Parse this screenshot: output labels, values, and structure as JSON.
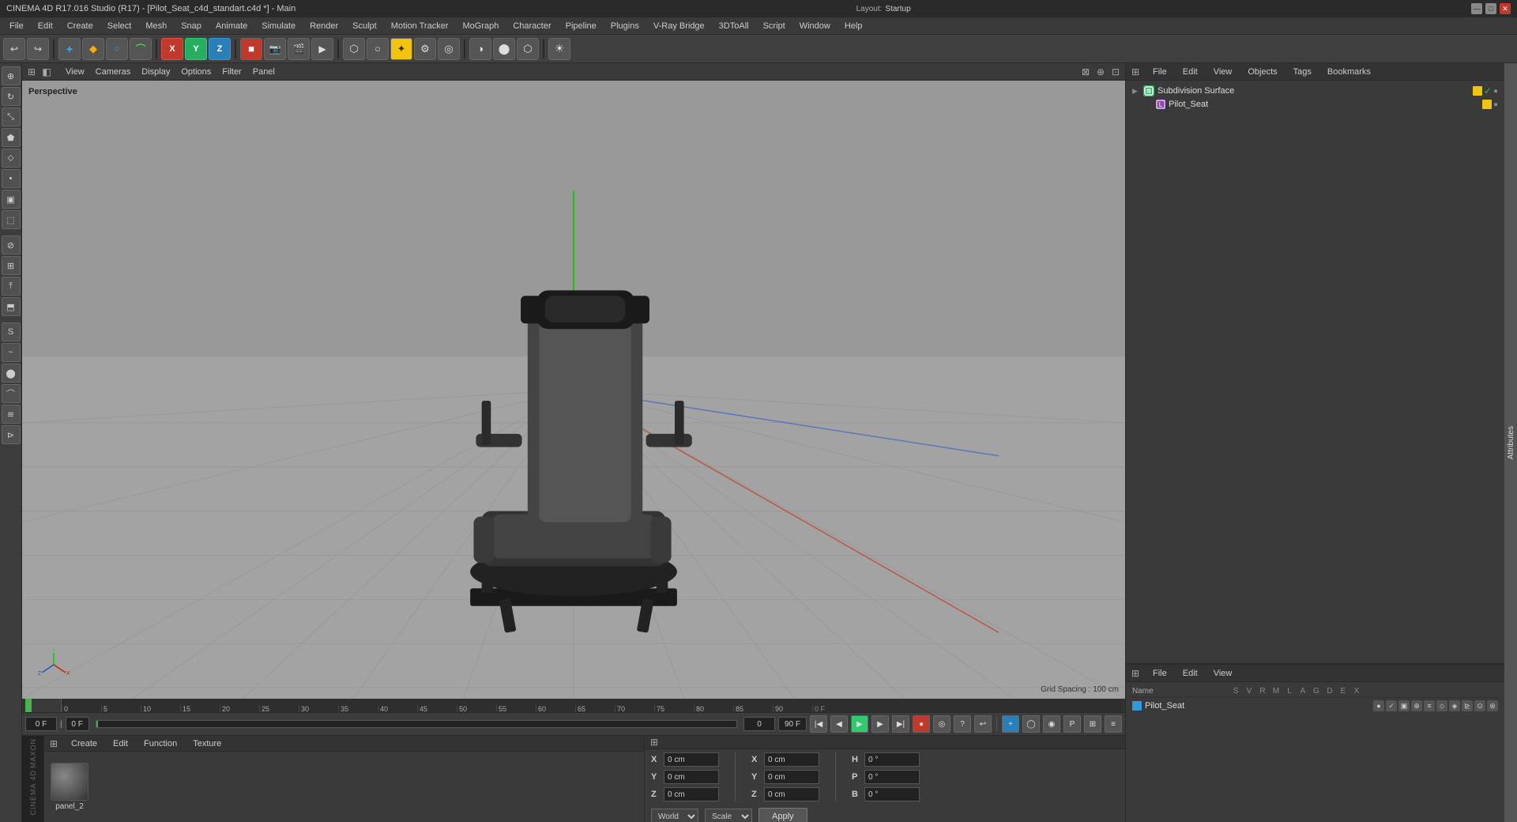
{
  "title_bar": {
    "text": "CINEMA 4D R17.016 Studio (R17) - [Pilot_Seat_c4d_standart.c4d *] - Main",
    "layout_label": "Layout:",
    "layout_value": "Startup",
    "btn_min": "—",
    "btn_max": "□",
    "btn_close": "✕"
  },
  "menu": {
    "items": [
      "File",
      "Edit",
      "Create",
      "Select",
      "Mesh",
      "Snap",
      "Animate",
      "Simulate",
      "Render",
      "Sculpt",
      "Motion Tracker",
      "MoGraph",
      "Character",
      "Pipeline",
      "Plugins",
      "V-Ray Bridge",
      "3DToAll",
      "Script",
      "Window",
      "Help"
    ]
  },
  "toolbar": {
    "undo": "↩",
    "redo": "↪"
  },
  "viewport": {
    "perspective_label": "Perspective",
    "grid_spacing": "Grid Spacing : 100 cm",
    "view_menu": [
      "View",
      "Cameras",
      "Display",
      "Options",
      "Filter",
      "Panel"
    ]
  },
  "objects_panel": {
    "header_items": [
      "File",
      "Edit",
      "View",
      "Objects",
      "Tags",
      "Bookmarks"
    ],
    "subdivision_surface": "Subdivision Surface",
    "pilot_seat": "Pilot_Seat"
  },
  "scene_panel": {
    "header_items": [
      "File",
      "Edit",
      "View"
    ],
    "columns": {
      "name": "Name",
      "cols": [
        "S",
        "V",
        "R",
        "M",
        "L",
        "A",
        "G",
        "D",
        "E",
        "X"
      ]
    },
    "rows": [
      {
        "name": "Pilot_Seat"
      }
    ]
  },
  "timeline": {
    "ticks": [
      0,
      5,
      10,
      15,
      20,
      25,
      30,
      35,
      40,
      45,
      50,
      55,
      60,
      65,
      70,
      75,
      80,
      85,
      90
    ],
    "current_frame": "0 F",
    "start_frame": "0 F",
    "end_frame": "90 F"
  },
  "material_panel": {
    "header_items": [
      "Create",
      "Edit",
      "Function",
      "Texture"
    ],
    "material_name": "panel_2"
  },
  "coords_panel": {
    "x_pos": "0 cm",
    "y_pos": "0 cm",
    "z_pos": "0 cm",
    "x_rot": "0 °",
    "y_rot": "0 °",
    "z_rot": "0 °",
    "h_val": "0 °",
    "p_val": "0 °",
    "b_val": "0 °",
    "pos_label": "X",
    "mode_world": "World",
    "mode_scale": "Scale",
    "apply_label": "Apply"
  },
  "right_strip": {
    "text": "Attributes"
  },
  "maxon": {
    "line1": "MAXON",
    "line2": "CINEMA 4D"
  }
}
